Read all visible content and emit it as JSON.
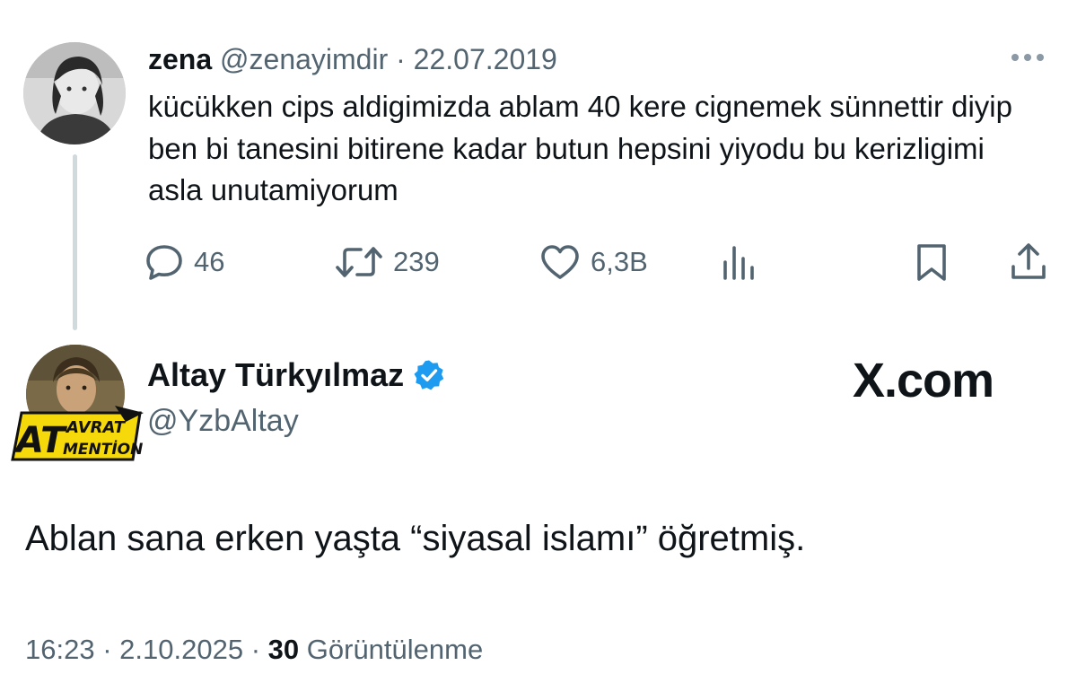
{
  "parent_tweet": {
    "author_name": "zena",
    "author_handle": "@zenayimdir",
    "separator": "·",
    "date": "22.07.2019",
    "text": "kücükken cips aldigimizda ablam 40 kere cignemek sünnettir diyip ben bi tanesini bitirene kadar butun hepsini yiyodu bu kerizligimi asla unutamiyorum",
    "actions": {
      "replies": "46",
      "retweets": "239",
      "likes": "6,3B"
    }
  },
  "reply_tweet": {
    "author_name": "Altay Türkyılmaz",
    "author_handle": "@YzbAltay",
    "verified": true,
    "text": "Ablan sana erken yaşta “siyasal islamı” öğretmiş.",
    "time": "16:23",
    "separator": "·",
    "date": "2.10.2025",
    "views_count": "30",
    "views_label": "Görüntülenme"
  },
  "watermark": "X.com",
  "badge": {
    "big_letters": "AT",
    "word1": "AVRAT",
    "word2": "MENTİON"
  },
  "colors": {
    "text_primary": "#0f1419",
    "text_secondary": "#536471",
    "thread_line": "#cfd9de",
    "verified_blue": "#1d9bf0",
    "badge_yellow": "#f5d90a"
  },
  "icons": {
    "more": "more-horizontal-icon",
    "reply": "reply-bubble-icon",
    "retweet": "retweet-icon",
    "like": "heart-icon",
    "views": "analytics-icon",
    "bookmark": "bookmark-icon",
    "share": "share-icon",
    "verified": "verified-badge-icon"
  }
}
